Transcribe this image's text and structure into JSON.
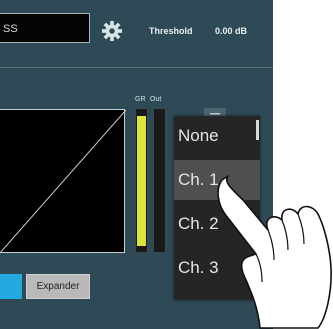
{
  "header": {
    "name_field_value": "SS",
    "threshold_label": "Threshold",
    "threshold_value": "0.00 dB"
  },
  "meters": {
    "gr_label": "GR",
    "out_label": "Out",
    "gr_level": 0.95,
    "out_level": 0.0
  },
  "dropdown": {
    "items": [
      "None",
      "Ch. 1",
      "Ch. 2",
      "Ch. 3"
    ],
    "selected": "Ch. 1"
  },
  "buttons": {
    "expander_label": "Expander"
  },
  "colors": {
    "panel": "#2e4a56",
    "meter_fill": "#dbe43a",
    "accent_blue": "#22a9e0",
    "menu_bg": "#252525",
    "menu_selected": "#4f4f4f"
  }
}
